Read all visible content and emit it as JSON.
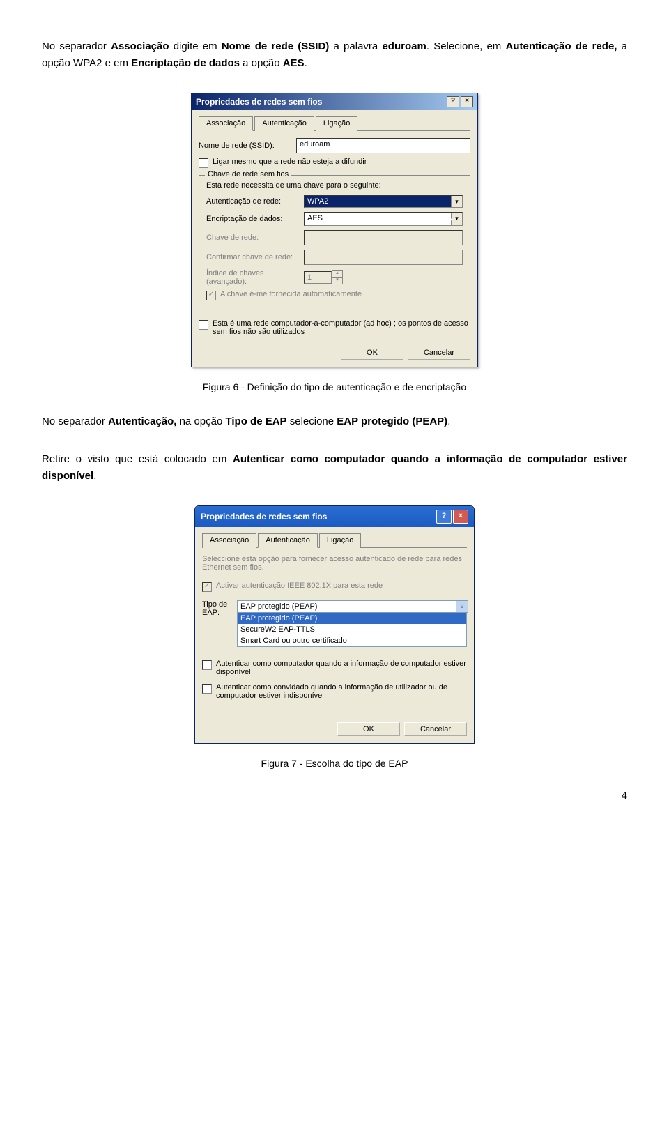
{
  "intro": {
    "p1a": "No separador ",
    "p1b": "Associação",
    "p1c": " digite em ",
    "p1d": "Nome de rede (SSID)",
    "p1e": " a palavra ",
    "p1f": "eduroam",
    "p1g": ". Selecione, em ",
    "p1h": "Autenticação de rede,",
    "p1i": " a opção WPA2 e em ",
    "p1j": "Encriptação de dados",
    "p1k": " a opção ",
    "p1l": "AES",
    "p1m": "."
  },
  "dlg1": {
    "title": "Propriedades de redes sem fios",
    "help": "?",
    "close": "×",
    "tabs": {
      "t1": "Associação",
      "t2": "Autenticação",
      "t3": "Ligação"
    },
    "ssid_label": "Nome de rede (SSID):",
    "ssid_value": "eduroam",
    "cb_connect": "Ligar mesmo que a rede não esteja a difundir",
    "fs_legend": "Chave de rede sem fios",
    "fs_desc": "Esta rede necessita de uma chave para o seguinte:",
    "auth_label": "Autenticação de rede:",
    "auth_value": "WPA2",
    "enc_label": "Encriptação de dados:",
    "enc_value": "AES",
    "key_label": "Chave de rede:",
    "confirm_label": "Confirmar chave de rede:",
    "index_label": "Índice de chaves (avançado):",
    "index_value": "1",
    "cb_auto": "A chave é-me fornecida automaticamente",
    "cb_adhoc": "Esta é uma rede computador-a-computador (ad hoc) ; os pontos de acesso sem fios não são utilizados",
    "ok": "OK",
    "cancel": "Cancelar"
  },
  "caption1": "Figura 6 - Definição do tipo de autenticação e de encriptação",
  "mid": {
    "p1a": "No separador ",
    "p1b": "Autenticação,",
    "p1c": " na opção ",
    "p1d": "Tipo de EAP",
    "p1e": " selecione ",
    "p1f": "EAP protegido (PEAP)",
    "p1g": ".",
    "p2a": "Retire o visto que está colocado em ",
    "p2b": "Autenticar como computador quando a informação de computador estiver disponível",
    "p2c": "."
  },
  "dlg2": {
    "title": "Propriedades de redes sem fios",
    "help": "?",
    "close": "×",
    "tabs": {
      "t1": "Associação",
      "t2": "Autenticação",
      "t3": "Ligação"
    },
    "desc": "Seleccione esta opção para fornecer acesso autenticado de rede para redes Ethernet sem fios.",
    "cb_ieee": "Activar autenticação IEEE 802.1X para esta rede",
    "eap_label": "Tipo de EAP:",
    "eap_value": "EAP protegido (PEAP)",
    "opt1": "EAP protegido (PEAP)",
    "opt2": "SecureW2 EAP-TTLS",
    "opt3": "Smart Card ou outro certificado",
    "cb_comp": "Autenticar como computador quando a informação de computador estiver disponível",
    "cb_guest": "Autenticar como convidado quando a informação de utilizador ou de computador estiver indisponível",
    "ok": "OK",
    "cancel": "Cancelar"
  },
  "caption2": "Figura 7 - Escolha do tipo de EAP",
  "page_num": "4"
}
